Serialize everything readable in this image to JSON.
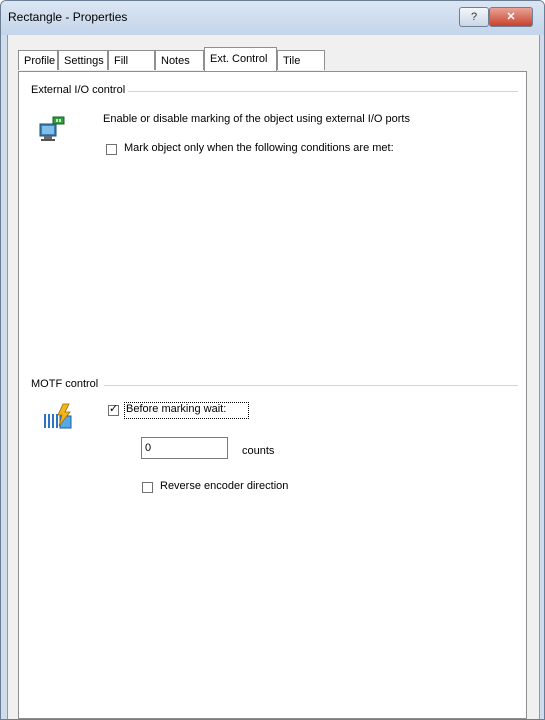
{
  "window": {
    "title": "Rectangle - Properties",
    "help_label": "?",
    "close_label": "✕"
  },
  "tabs": [
    {
      "label": "Profile"
    },
    {
      "label": "Settings"
    },
    {
      "label": "Fill"
    },
    {
      "label": "Notes"
    },
    {
      "label": "Ext. Control"
    },
    {
      "label": "Tile"
    }
  ],
  "active_tab": "Ext. Control",
  "external_io": {
    "group_label": "External I/O control",
    "description": "Enable or disable marking of the object using external I/O ports",
    "icon": "external-io-icon",
    "condition_checkbox": {
      "label": "Mark object only when the following conditions are met:",
      "checked": false
    }
  },
  "motf": {
    "group_label": "MOTF control",
    "icon": "encoder-lightning-icon",
    "wait_checkbox": {
      "label": "Before marking wait:",
      "checked": true
    },
    "counts_value": "0",
    "counts_label": "counts",
    "reverse_checkbox": {
      "label": "Reverse encoder direction",
      "checked": false
    }
  },
  "colors": {
    "title_bar": "#c4d5ea",
    "close_button": "#c7412b"
  }
}
